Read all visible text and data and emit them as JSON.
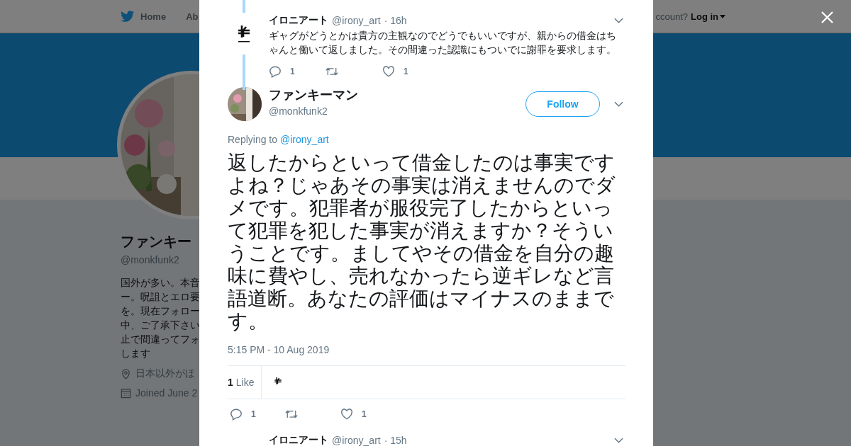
{
  "nav": {
    "home": "Home",
    "partial_item": "Ab",
    "account_text": "ccount?",
    "login": "Log in"
  },
  "profile": {
    "name": "ファンキー",
    "handle": "@monkfunk2",
    "bio_lines": [
      "国外が多い。本音",
      "ー。呪詛とエロ要",
      "を。現在フォロー",
      "中、ご了承下さい",
      "止で間違ってフォ",
      "します"
    ],
    "location": "日本以外がほ",
    "joined": "Joined June 2"
  },
  "parent_tweet": {
    "name": "イロニアート",
    "handle": "@irony_art",
    "time": "· 16h",
    "text": "ギャグがどうとかは貴方の主観なのでどうでもいいですが、親からの借金はちゃんと働いて返しました。その間違った認識にもついでに謝罪を要求します。",
    "replies": "1",
    "likes": "1"
  },
  "main_tweet": {
    "name": "ファンキーマン",
    "handle": "@monkfunk2",
    "follow": "Follow",
    "replying_prefix": "Replying to",
    "replying_to": "@irony_art",
    "text": "返したからといって借金したのは事実ですよね？じゃあその事実は消えませんのでダメです。犯罪者が服役完了したからといって犯罪を犯した事実が消えますか？そういうことです。ましてやその借金を自分の趣味に費やし、売れなかったら逆ギレなど言語道断。あなたの評価はマイナスのままです。",
    "timestamp": "5:15 PM - 10 Aug 2019",
    "like_count": "1",
    "like_label": "Like",
    "replies": "1",
    "likes": "1"
  },
  "next_tweet": {
    "name": "イロニアート",
    "handle": "@irony_art",
    "time": "· 15h"
  }
}
